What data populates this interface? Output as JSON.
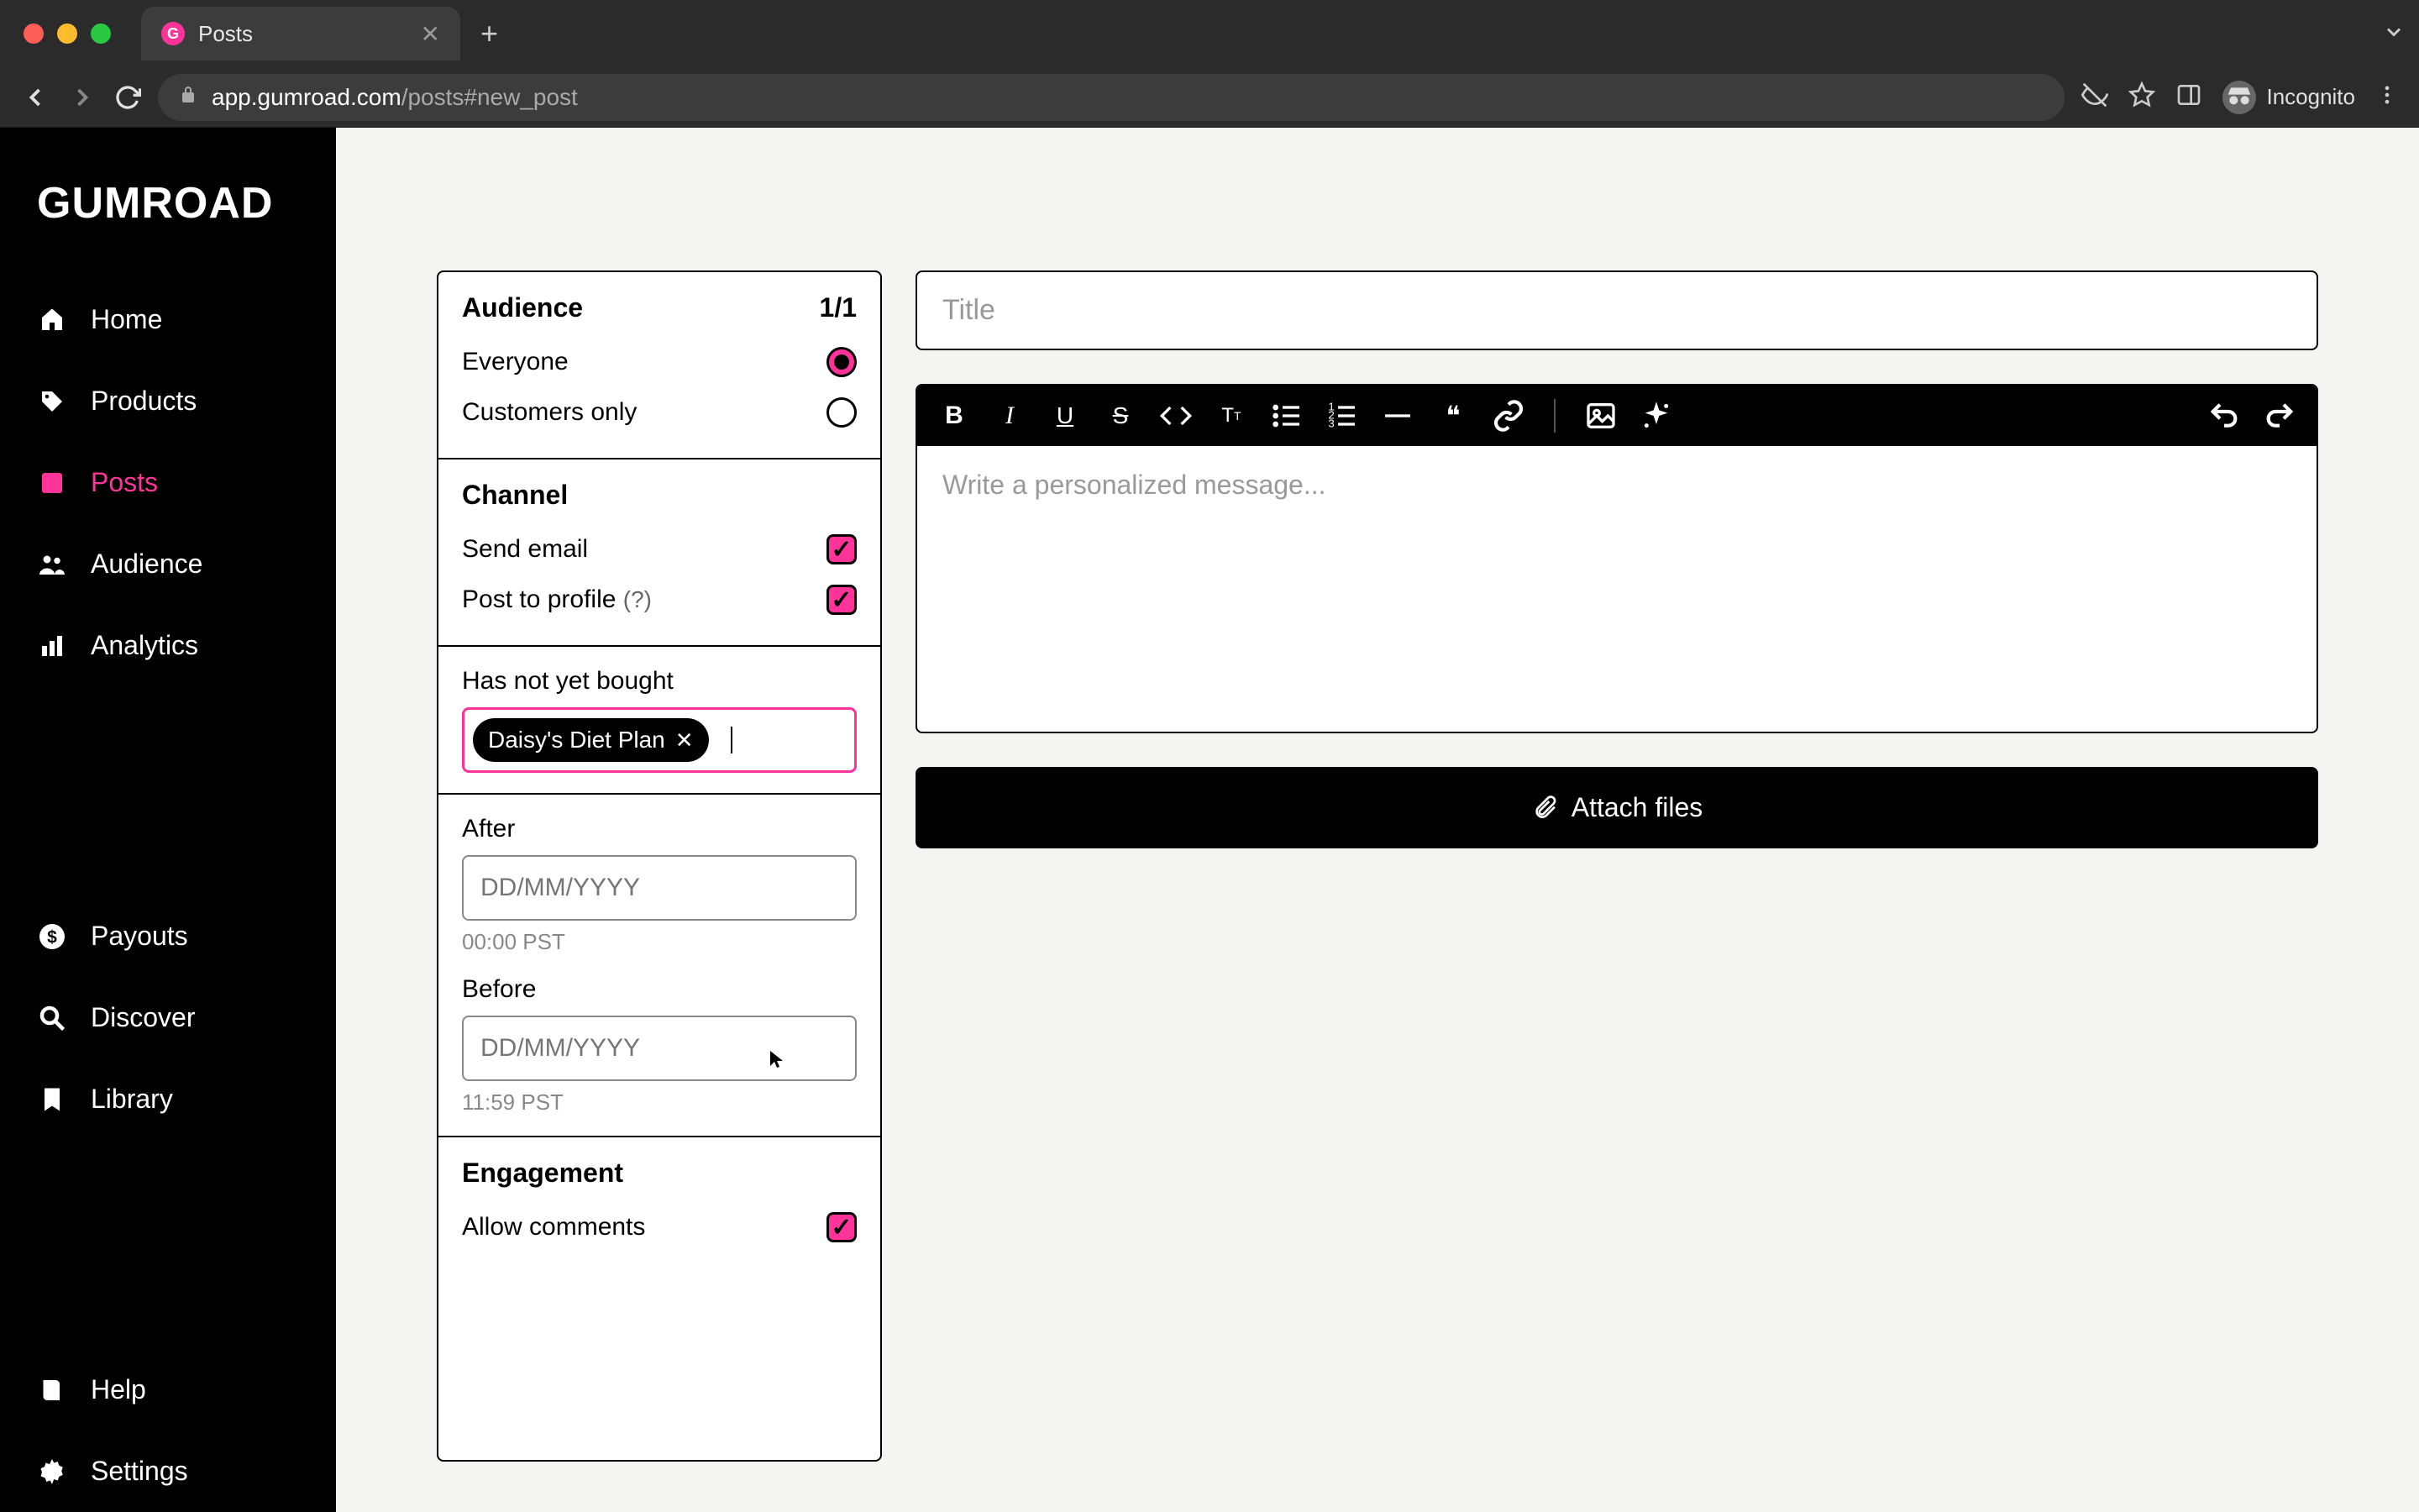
{
  "browser": {
    "tab_title": "Posts",
    "url_host": "app.gumroad.com",
    "url_path": "/posts#new_post",
    "incognito_label": "Incognito"
  },
  "sidebar": {
    "logo": "GUMROAD",
    "items": [
      {
        "label": "Home"
      },
      {
        "label": "Products"
      },
      {
        "label": "Posts"
      },
      {
        "label": "Audience"
      },
      {
        "label": "Analytics"
      }
    ],
    "items2": [
      {
        "label": "Payouts"
      },
      {
        "label": "Discover"
      },
      {
        "label": "Library"
      }
    ],
    "items3": [
      {
        "label": "Help"
      },
      {
        "label": "Settings"
      }
    ]
  },
  "panel": {
    "audience": {
      "heading": "Audience",
      "count": "1/1",
      "everyone": "Everyone",
      "customers_only": "Customers only"
    },
    "channel": {
      "heading": "Channel",
      "send_email": "Send email",
      "post_to_profile": "Post to profile",
      "help": "(?)"
    },
    "filter": {
      "label": "Has not yet bought",
      "tag": "Daisy's Diet Plan"
    },
    "dates": {
      "after_label": "After",
      "after_placeholder": "DD/MM/YYYY",
      "after_hint": "00:00 PST",
      "before_label": "Before",
      "before_placeholder": "DD/MM/YYYY",
      "before_hint": "11:59 PST"
    },
    "engagement": {
      "heading": "Engagement",
      "allow_comments": "Allow comments"
    }
  },
  "editor": {
    "title_placeholder": "Title",
    "body_placeholder": "Write a personalized message...",
    "attach_label": "Attach files"
  },
  "colors": {
    "accent": "#ff3399",
    "bg": "#f4f4f0"
  }
}
